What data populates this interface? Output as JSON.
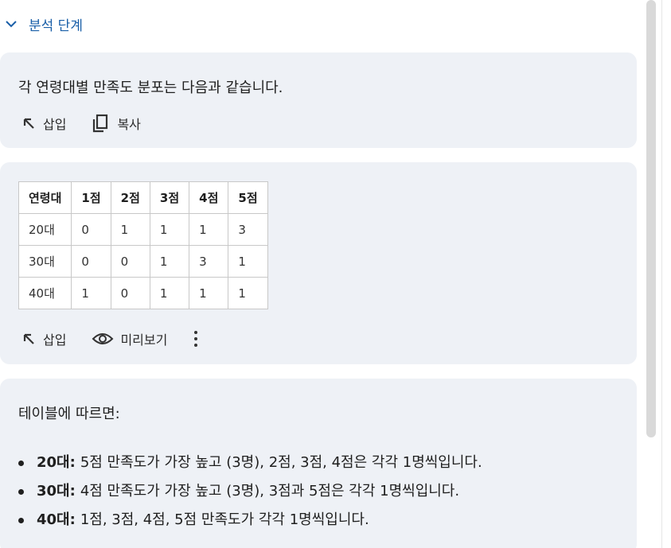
{
  "header": {
    "title": "분석 단계",
    "icon": "chevron-down-icon"
  },
  "intro": {
    "text": "각 연령대별 만족도 분포는 다음과 같습니다."
  },
  "card1_actions": {
    "insert": "삽입",
    "copy": "복사"
  },
  "table": {
    "headers": [
      "연령대",
      "1점",
      "2점",
      "3점",
      "4점",
      "5점"
    ],
    "rows": [
      [
        "20대",
        "0",
        "1",
        "1",
        "1",
        "3"
      ],
      [
        "30대",
        "0",
        "0",
        "1",
        "3",
        "1"
      ],
      [
        "40대",
        "1",
        "0",
        "1",
        "1",
        "1"
      ]
    ]
  },
  "card2_actions": {
    "insert": "삽입",
    "preview": "미리보기"
  },
  "summary": {
    "text": "테이블에 따르면:",
    "bullets": [
      {
        "label": "20대:",
        "text": "5점 만족도가 가장 높고 (3명), 2점, 3점, 4점은 각각 1명씩입니다."
      },
      {
        "label": "30대:",
        "text": "4점 만족도가 가장 높고 (3명), 3점과 5점은 각각 1명씩입니다."
      },
      {
        "label": "40대:",
        "text": "1점, 3점, 4점, 5점 만족도가 각각 1명씩입니다."
      }
    ]
  },
  "colors": {
    "accent": "#1a5fa8",
    "card_bg": "#eef1f6",
    "scrollbar": "#d9d9d9"
  }
}
